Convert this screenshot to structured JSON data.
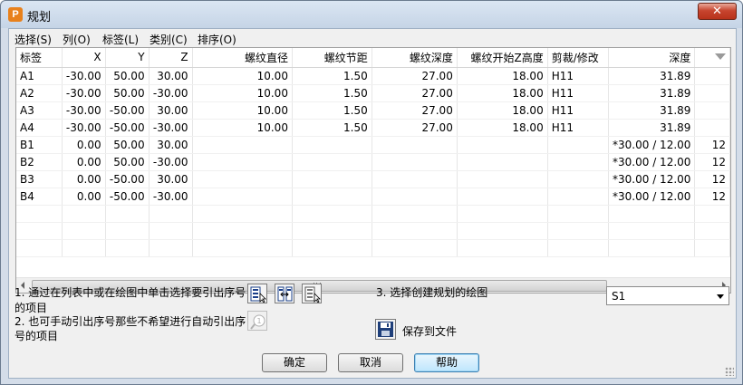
{
  "window": {
    "title": "规划",
    "close_label": "✕"
  },
  "menu": [
    "选择(S)",
    "列(O)",
    "标签(L)",
    "类别(C)",
    "排序(O)"
  ],
  "table": {
    "columns": [
      "标签",
      "X",
      "Y",
      "Z",
      "螺纹直径",
      "螺纹节距",
      "螺纹深度",
      "螺纹开始Z高度",
      "剪裁/修改",
      "深度",
      ""
    ],
    "rows": [
      [
        "A1",
        "-30.00",
        "50.00",
        "30.00",
        "10.00",
        "1.50",
        "27.00",
        "18.00",
        "H11",
        "31.89",
        ""
      ],
      [
        "A2",
        "-30.00",
        "50.00",
        "-30.00",
        "10.00",
        "1.50",
        "27.00",
        "18.00",
        "H11",
        "31.89",
        ""
      ],
      [
        "A3",
        "-30.00",
        "-50.00",
        "30.00",
        "10.00",
        "1.50",
        "27.00",
        "18.00",
        "H11",
        "31.89",
        ""
      ],
      [
        "A4",
        "-30.00",
        "-50.00",
        "-30.00",
        "10.00",
        "1.50",
        "27.00",
        "18.00",
        "H11",
        "31.89",
        ""
      ],
      [
        "B1",
        "0.00",
        "50.00",
        "30.00",
        "",
        "",
        "",
        "",
        "",
        "*30.00 / 12.00",
        "12"
      ],
      [
        "B2",
        "0.00",
        "50.00",
        "-30.00",
        "",
        "",
        "",
        "",
        "",
        "*30.00 / 12.00",
        "12"
      ],
      [
        "B3",
        "0.00",
        "-50.00",
        "30.00",
        "",
        "",
        "",
        "",
        "",
        "*30.00 / 12.00",
        "12"
      ],
      [
        "B4",
        "0.00",
        "-50.00",
        "-30.00",
        "",
        "",
        "",
        "",
        "",
        "*30.00 / 12.00",
        "12"
      ],
      [
        "",
        "",
        "",
        "",
        "",
        "",
        "",
        "",
        "",
        "",
        ""
      ],
      [
        "",
        "",
        "",
        "",
        "",
        "",
        "",
        "",
        "",
        "",
        ""
      ],
      [
        "",
        "",
        "",
        "",
        "",
        "",
        "",
        "",
        "",
        "",
        ""
      ]
    ]
  },
  "instructions": {
    "step1_line1": "1. 通过在列表中或在绘图中单击选择要引出序号",
    "step1_line2": "的项目",
    "step2_line1": "2. 也可手动引出序号那些不希望进行自动引出序",
    "step2_line2": "号的项目",
    "step3": "3. 选择创建规划的绘图"
  },
  "drawing_select": {
    "value": "S1"
  },
  "save_to_file_label": "保存到文件",
  "buttons": {
    "ok": "确定",
    "cancel": "取消",
    "help": "帮助"
  }
}
